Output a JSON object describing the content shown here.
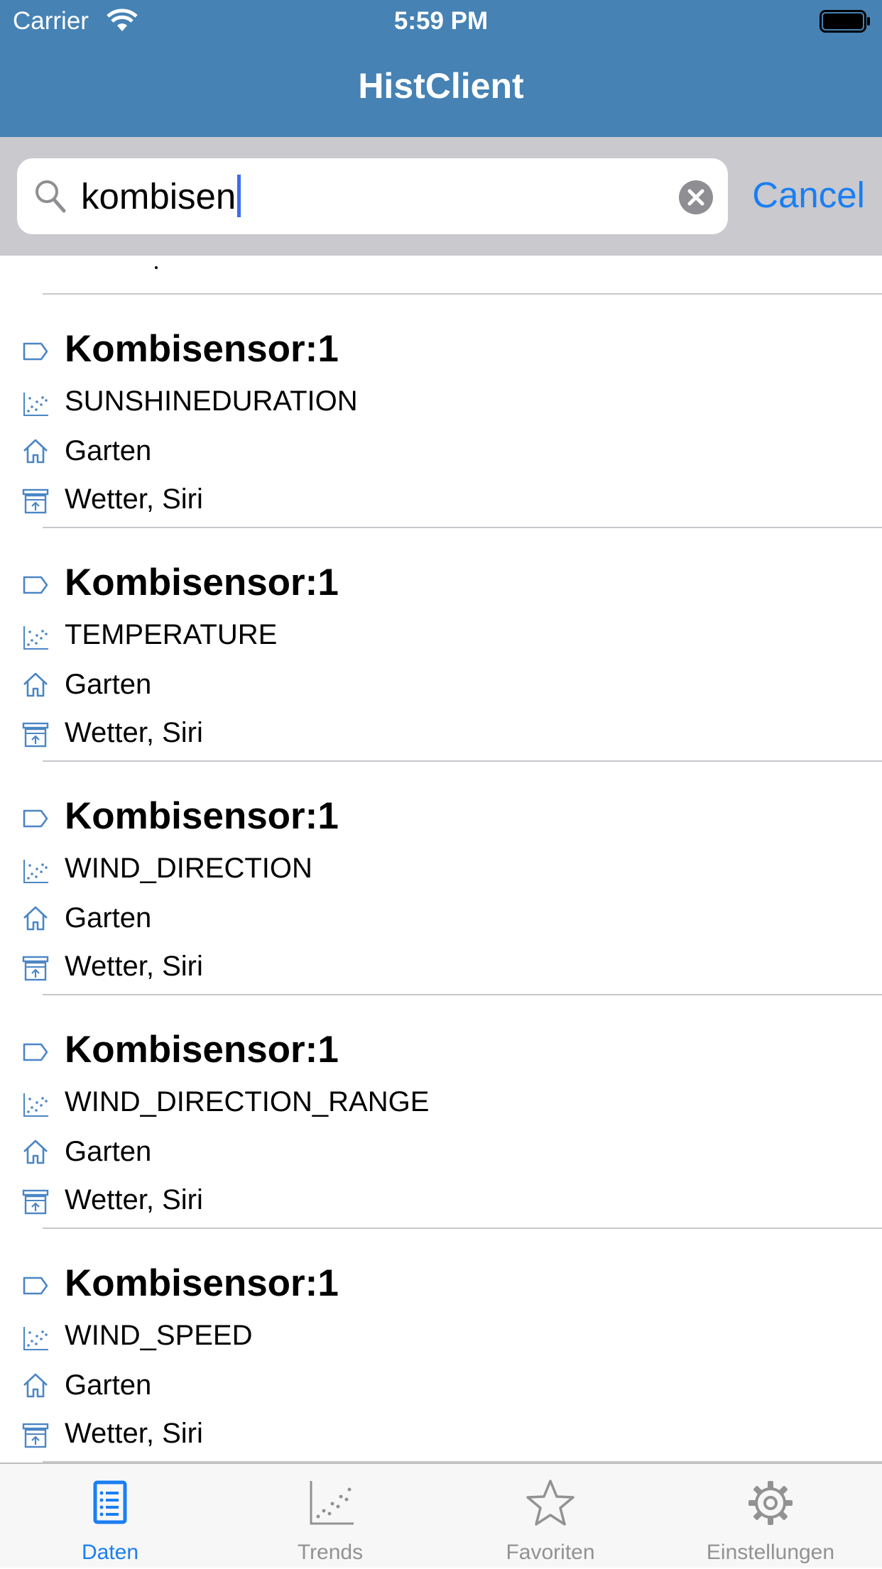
{
  "status_bar": {
    "carrier": "Carrier",
    "time": "5:59 PM"
  },
  "nav": {
    "title": "HistClient"
  },
  "search": {
    "query": "kombisen",
    "cancel_label": "Cancel"
  },
  "colors": {
    "accent": "#1a7ef2",
    "nav_background": "#4682b4",
    "icon_blue": "#4a86c5",
    "tab_inactive": "#929292"
  },
  "results": [
    {
      "name": "Kombisensor:1",
      "variable": "SUNSHINEDURATION",
      "location": "Garten",
      "categories": "Wetter, Siri"
    },
    {
      "name": "Kombisensor:1",
      "variable": "TEMPERATURE",
      "location": "Garten",
      "categories": "Wetter, Siri"
    },
    {
      "name": "Kombisensor:1",
      "variable": "WIND_DIRECTION",
      "location": "Garten",
      "categories": "Wetter, Siri"
    },
    {
      "name": "Kombisensor:1",
      "variable": "WIND_DIRECTION_RANGE",
      "location": "Garten",
      "categories": "Wetter, Siri"
    },
    {
      "name": "Kombisensor:1",
      "variable": "WIND_SPEED",
      "location": "Garten",
      "categories": "Wetter, Siri"
    }
  ],
  "icons": {
    "name": "tag-icon",
    "variable": "scatter-chart-icon",
    "location": "home-icon",
    "categories": "archive-box-icon"
  },
  "tabs": [
    {
      "label": "Daten",
      "icon": "list-document-icon",
      "active": true
    },
    {
      "label": "Trends",
      "icon": "scatter-chart-icon",
      "active": false
    },
    {
      "label": "Favoriten",
      "icon": "star-icon",
      "active": false
    },
    {
      "label": "Einstellungen",
      "icon": "gear-icon",
      "active": false
    }
  ]
}
